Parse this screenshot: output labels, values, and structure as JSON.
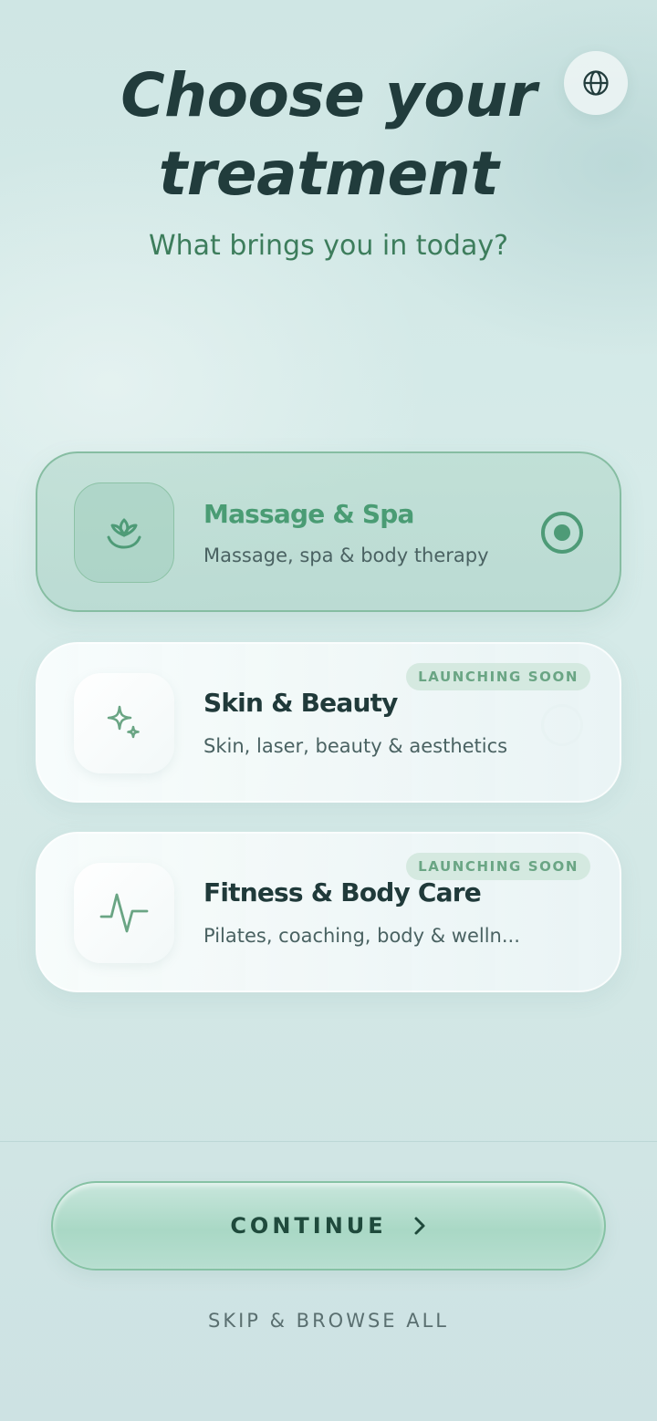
{
  "header": {
    "title_line1": "Choose your",
    "title_line2": "treatment",
    "subtitle": "What brings you in today?",
    "language_icon": "globe-icon"
  },
  "options": [
    {
      "title": "Massage & Spa",
      "description": "Massage, spa & body therapy",
      "icon": "lotus-icon",
      "selected": true,
      "badge": ""
    },
    {
      "title": "Skin & Beauty",
      "description": "Skin, laser, beauty & aesthetics",
      "icon": "sparkle-icon",
      "selected": false,
      "badge": "LAUNCHING SOON"
    },
    {
      "title": "Fitness & Body Care",
      "description": "Pilates, coaching, body & welln...",
      "icon": "pulse-icon",
      "selected": false,
      "badge": "LAUNCHING SOON"
    }
  ],
  "footer": {
    "continue_label": "CONTINUE",
    "continue_icon": "chevron-right-icon",
    "skip_label": "SKIP & BROWSE ALL"
  },
  "colors": {
    "accent": "#4e9b77",
    "title": "#213c3c",
    "subtitle": "#3d7d5c",
    "badge_text": "#6aa584"
  }
}
